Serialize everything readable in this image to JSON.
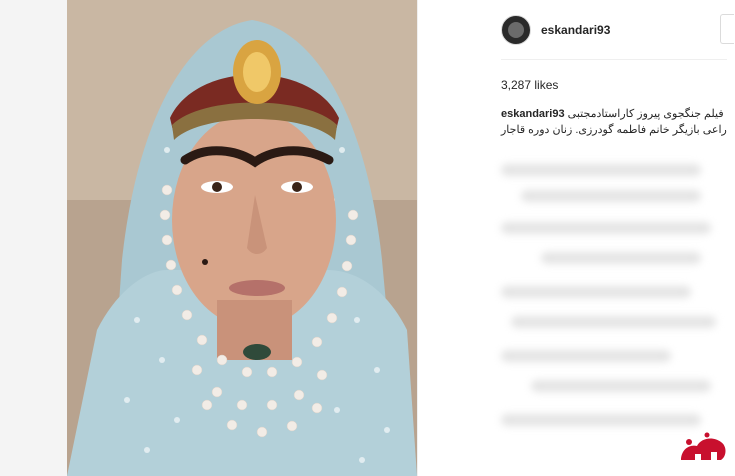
{
  "post": {
    "username": "eskandari93",
    "likes": "3,287 likes",
    "caption_user": "eskandari93",
    "caption_text": "فیلم جنگجوی پیروز کاراستادمجتبی راعی بازیگر خانم فاطمه گودرزی. زنان دوره قاجار"
  },
  "watermark": {
    "text": "فرا"
  },
  "colors": {
    "accent": "#c8102e",
    "scarf": "#a9c8d2",
    "background_photo": "#c7b6a4"
  },
  "icons": {
    "avatar": "profile-avatar",
    "watermark": "fararu-logo"
  }
}
